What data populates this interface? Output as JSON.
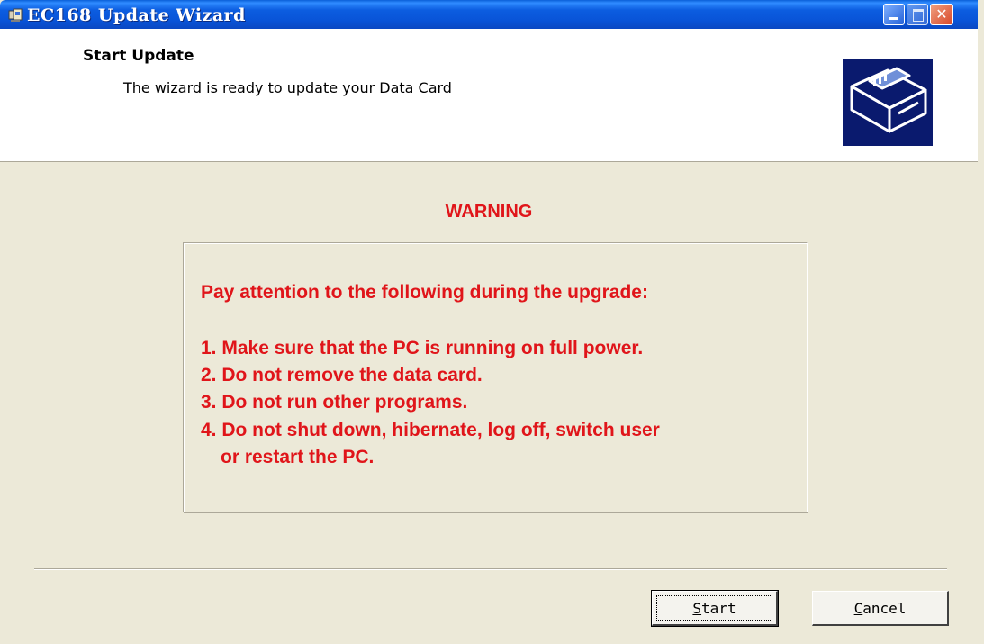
{
  "window": {
    "title": "EC168 Update Wizard",
    "title_icon": "app-icon",
    "controls": {
      "minimize": "minimize-icon",
      "maximize": "maximize-icon",
      "close": "close-icon"
    }
  },
  "header": {
    "title": "Start Update",
    "subtitle": "The wizard is ready to update your Data Card",
    "image": "data-card-icon"
  },
  "warning": {
    "label": "WARNING",
    "heading": "Pay attention to the following during the upgrade:",
    "items": [
      "1. Make sure that the PC is running on full power.",
      "2. Do not remove the data card.",
      "3. Do not run other programs.",
      "4. Do not shut down, hibernate, log off, switch user"
    ],
    "item4_continued": "or restart the PC."
  },
  "buttons": {
    "start_mnemonic": "S",
    "start_rest": "tart",
    "cancel_mnemonic": "C",
    "cancel_rest": "ancel"
  },
  "colors": {
    "warning": "#e0151a",
    "titlebar": "#0a5fd8",
    "dialog_bg": "#ece9d8"
  }
}
